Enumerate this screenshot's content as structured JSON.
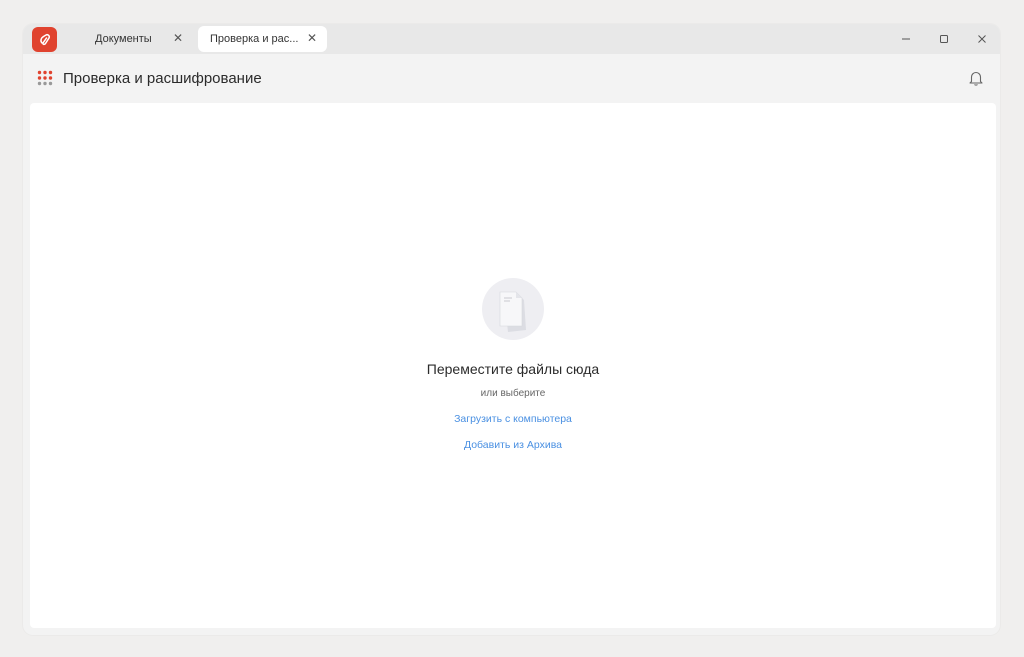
{
  "tabs": [
    {
      "label": "Документы",
      "close": "✕"
    },
    {
      "label": "Проверка и рас...",
      "close": "✕"
    }
  ],
  "window_controls": {
    "minimize_icon": "minimize-icon",
    "maximize_icon": "maximize-icon",
    "close_icon": "close-icon"
  },
  "header": {
    "title": "Проверка и расшифрование"
  },
  "dropzone": {
    "title": "Переместите файлы сюда",
    "or": "или выберите",
    "upload_link": "Загрузить с компьютера",
    "archive_link": "Добавить из Архива"
  },
  "colors": {
    "brand": "#e0432f",
    "link": "#4a90e2"
  }
}
